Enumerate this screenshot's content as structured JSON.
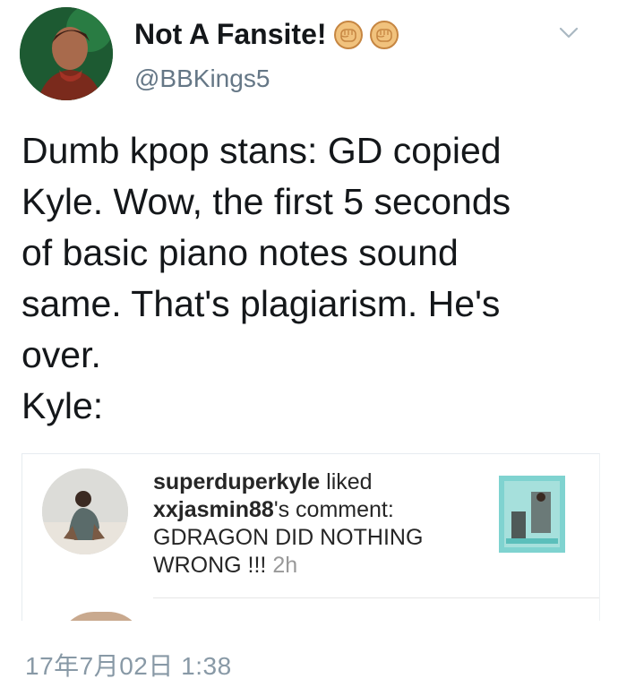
{
  "header": {
    "display_name": "Not A Fansite!",
    "emoji_icons": [
      "oncoming-fist-icon",
      "oncoming-fist-icon"
    ],
    "handle": "@BBKings5"
  },
  "tweet": {
    "text": "Dumb kpop stans: GD copied\nKyle. Wow, the first 5 seconds\nof basic piano notes sound\nsame. That's plagiarism. He's\nover.\nKyle:"
  },
  "embed": {
    "user": "superduperkyle",
    "action": " liked",
    "commenter": "xxjasmin88",
    "comment_intro": "'s comment:",
    "comment": "GDRAGON DID NOTHING WRONG !!!",
    "time": "2h"
  },
  "footer": {
    "timestamp": "17年7月02日 1:38"
  },
  "colors": {
    "handle_gray": "#657786",
    "timestamp_gray": "#8899a6",
    "embed_time_gray": "#999999"
  }
}
